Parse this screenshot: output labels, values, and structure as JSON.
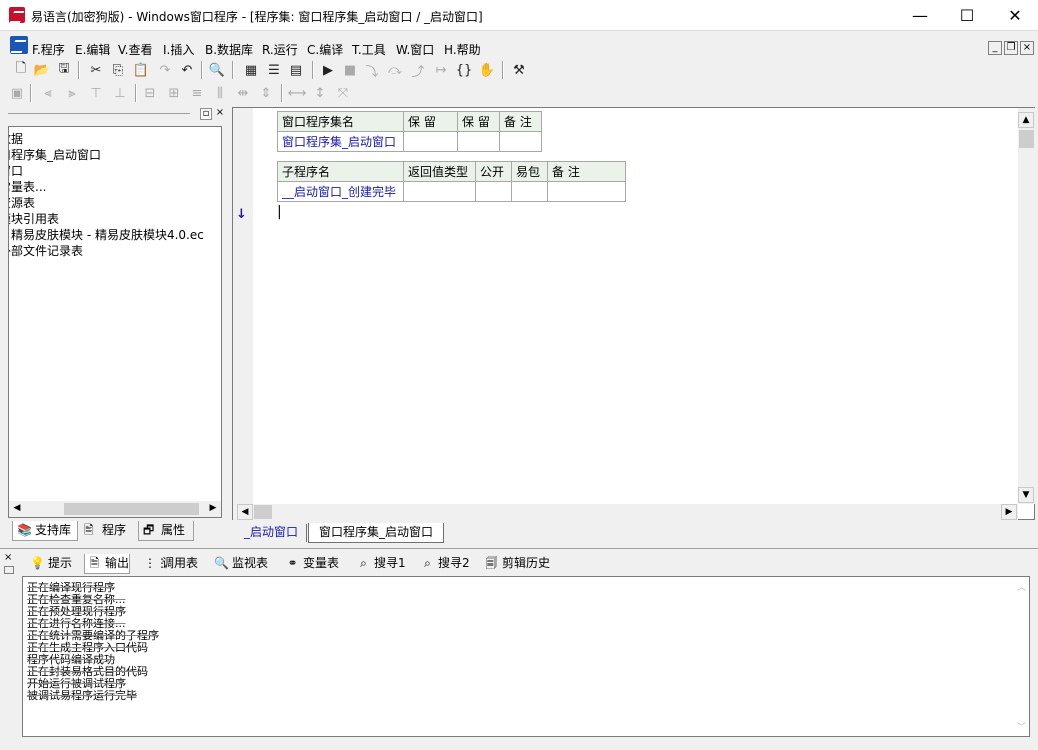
{
  "window": {
    "title": "易语言(加密狗版) - Windows窗口程序 - [程序集: 窗口程序集_启动窗口 / _启动窗口]",
    "minimize": "—",
    "maximize": "☐",
    "close": "✕"
  },
  "menu": {
    "items": [
      "F.程序",
      "E.编辑",
      "V.查看",
      "I.插入",
      "B.数据库",
      "R.运行",
      "C.编译",
      "T.工具",
      "W.窗口",
      "H.帮助"
    ],
    "mdi_min": "_",
    "mdi_restore": "❐",
    "mdi_close": "×"
  },
  "left_panel": {
    "close_glyph": "×",
    "pin_glyph": "▫",
    "tree": [
      "数据",
      "窗口程序集_启动窗口",
      "窗口",
      "常量表...",
      "资源表",
      "模块引用表",
      "  精易皮肤模块 - 精易皮肤模块4.0.ec",
      "外部文件记录表"
    ],
    "tabs": [
      "支持库",
      "程序",
      "属性"
    ]
  },
  "editor": {
    "table1": {
      "headers": [
        "窗口程序集名",
        "保 留",
        "保 留",
        "备 注"
      ],
      "row": [
        "窗口程序集_启动窗口",
        "",
        "",
        ""
      ]
    },
    "table2": {
      "headers": [
        "子程序名",
        "返回值类型",
        "公开",
        "易包",
        "备 注"
      ],
      "row": [
        "__启动窗口_创建完毕",
        "",
        "",
        "",
        ""
      ]
    },
    "cursor": "|",
    "arrow": "↓",
    "tabs": [
      "_启动窗口",
      "窗口程序集_启动窗口"
    ]
  },
  "bottom": {
    "tabs": [
      "提示",
      "输出",
      "调用表",
      "监视表",
      "变量表",
      "搜寻1",
      "搜寻2",
      "剪辑历史"
    ],
    "output_lines": [
      "正在编译现行程序",
      "正在检查重复名称...",
      "正在预处理现行程序",
      "正在进行名称连接...",
      "正在统计需要编译的子程序",
      "正在生成主程序入口代码",
      "程序代码编译成功",
      "正在封装易格式目的代码",
      "开始运行被调试程序",
      "被调试易程序运行完毕"
    ]
  }
}
